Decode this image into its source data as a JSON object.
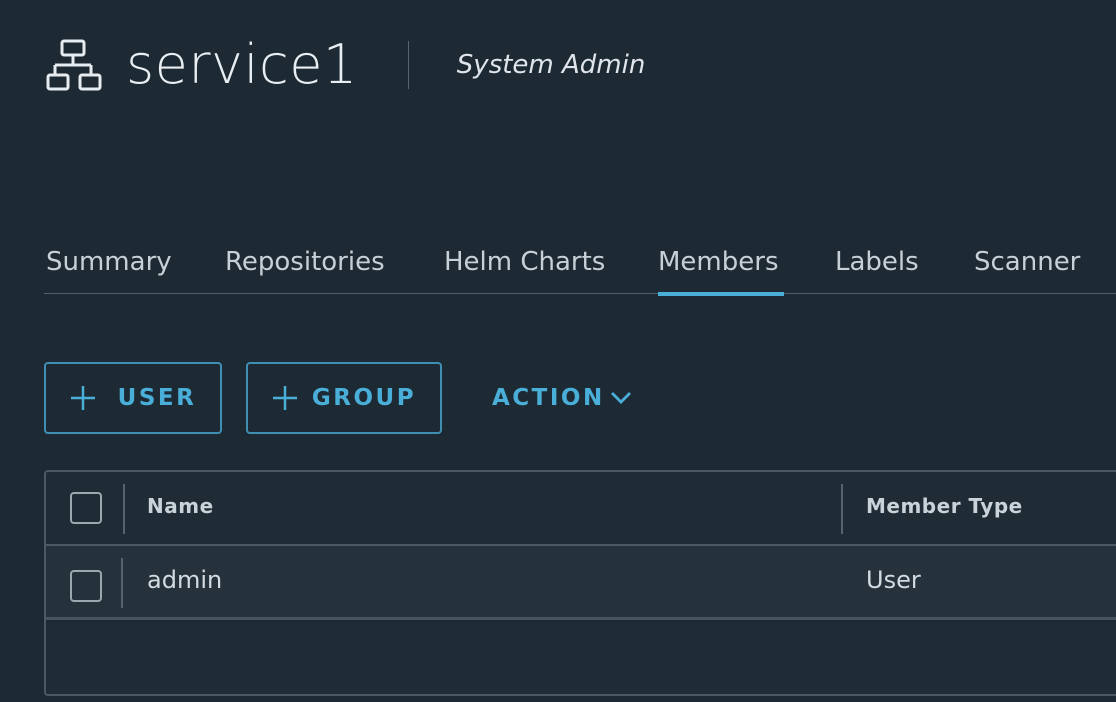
{
  "header": {
    "project_icon": "network-tree-icon",
    "project_name": "service1",
    "role": "System Admin"
  },
  "tabs": [
    {
      "label": "Summary",
      "active": false
    },
    {
      "label": "Repositories",
      "active": false
    },
    {
      "label": "Helm Charts",
      "active": false
    },
    {
      "label": "Members",
      "active": true
    },
    {
      "label": "Labels",
      "active": false
    },
    {
      "label": "Scanner",
      "active": false
    }
  ],
  "toolbar": {
    "add_user_label": "USER",
    "add_group_label": "GROUP",
    "action_label": "ACTION",
    "plus_icon": "plus-icon",
    "chevron_icon": "chevron-down-icon"
  },
  "table": {
    "columns": [
      "Name",
      "Member Type"
    ],
    "rows": [
      {
        "name": "admin",
        "member_type": "User"
      }
    ]
  },
  "colors": {
    "background": "#1e2a33",
    "accent": "#49afd9",
    "border": "#4a5963"
  }
}
